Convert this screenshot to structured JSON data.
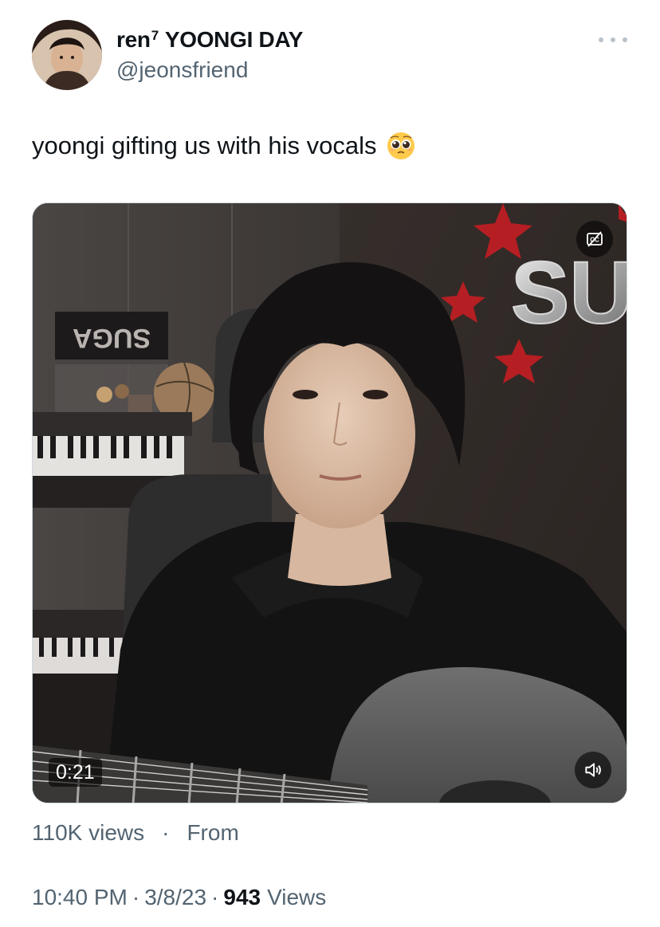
{
  "author": {
    "name_prefix": "ren",
    "name_sup": "7",
    "name_rest": "YOONGI DAY",
    "handle": "@jeonsfriend",
    "avatar_icon": "profile-photo"
  },
  "tweet": {
    "text": "yoongi gifting us with his vocals",
    "emoji": "pleading-face-emoji"
  },
  "media": {
    "type": "video",
    "duration": "0:21",
    "sign_text": "SUGA",
    "balloon_letters": "SU",
    "cc_icon": "captions-off-icon",
    "volume_icon": "speaker-icon"
  },
  "stats": {
    "views": "110K views",
    "dot": "·",
    "from": "From"
  },
  "meta": {
    "time": "10:40 PM",
    "sep": "·",
    "date": "3/8/23",
    "count": "943",
    "views_label": "Views"
  }
}
